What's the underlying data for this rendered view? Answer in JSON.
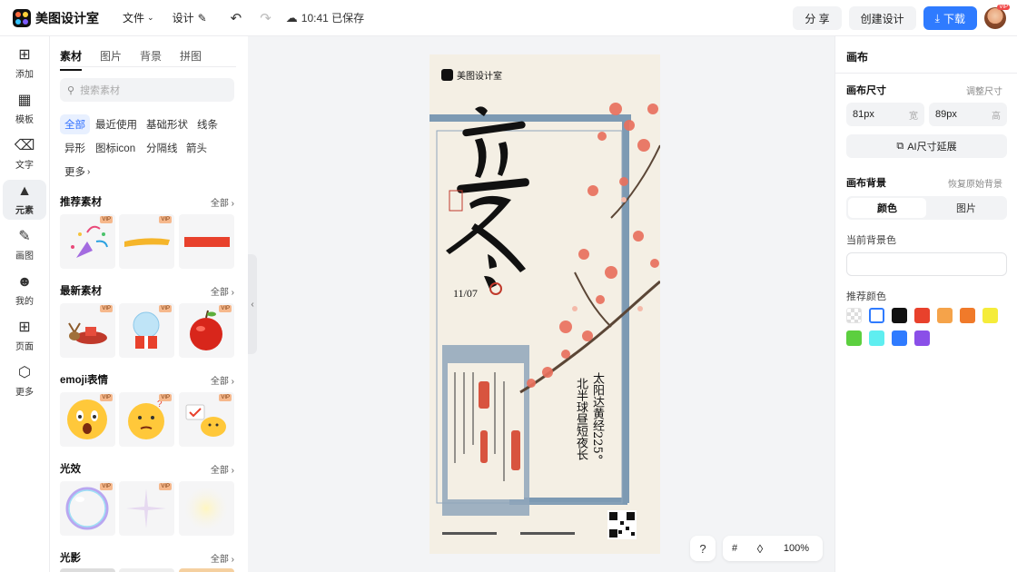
{
  "app": {
    "name": "美图设计室"
  },
  "topbar": {
    "file_menu": "文件",
    "design_menu": "设计",
    "save_status": "10:41 已保存",
    "share_label": "分 享",
    "create_label": "创建设计",
    "download_label": "下载",
    "avatar_badge": "VIP"
  },
  "rail": {
    "items": [
      {
        "label": "添加",
        "icon": "plus-square-icon"
      },
      {
        "label": "模板",
        "icon": "template-icon"
      },
      {
        "label": "文字",
        "icon": "text-icon"
      },
      {
        "label": "元素",
        "icon": "shapes-icon"
      },
      {
        "label": "画图",
        "icon": "draw-icon"
      },
      {
        "label": "我的",
        "icon": "user-icon"
      },
      {
        "label": "页面",
        "icon": "page-add-icon"
      },
      {
        "label": "更多",
        "icon": "cube-icon"
      }
    ]
  },
  "panel": {
    "tabs": [
      "素材",
      "图片",
      "背景",
      "拼图"
    ],
    "search_placeholder": "搜索素材",
    "filters": [
      "全部",
      "最近使用",
      "基础形状",
      "线条",
      "异形",
      "图标icon",
      "分隔线",
      "箭头",
      "更多"
    ],
    "all_label": "全部",
    "vip_label": "VIP",
    "sections": [
      {
        "title": "推荐素材"
      },
      {
        "title": "最新素材"
      },
      {
        "title": "emoji表情"
      },
      {
        "title": "光效"
      },
      {
        "title": "光影"
      }
    ]
  },
  "poster": {
    "brand": "美图设计室",
    "title": "立冬",
    "date": "11/07",
    "line1": "太阳达黄经225°",
    "line2": "北半球昼短夜长"
  },
  "props": {
    "title": "画布",
    "size_label": "画布尺寸",
    "size_action": "调整尺寸",
    "width_value": "81px",
    "width_unit": "宽",
    "height_value": "89px",
    "height_unit": "高",
    "ai_extend": "AI尺寸延展",
    "bg_label": "画布背景",
    "bg_reset": "恢复原始背景",
    "bg_tab_color": "颜色",
    "bg_tab_image": "图片",
    "current_bg": "当前背景色",
    "recommended": "推荐颜色",
    "swatches": [
      "transparent",
      "#ffffff",
      "#111111",
      "#e8412c",
      "#f5a34a",
      "#f07a2a",
      "#f5ec3a",
      "#5ccf3f",
      "#5feef0",
      "#2f7bff",
      "#8a4fe8"
    ]
  },
  "canvas_tools": {
    "help": "?",
    "zoom": "100%"
  }
}
